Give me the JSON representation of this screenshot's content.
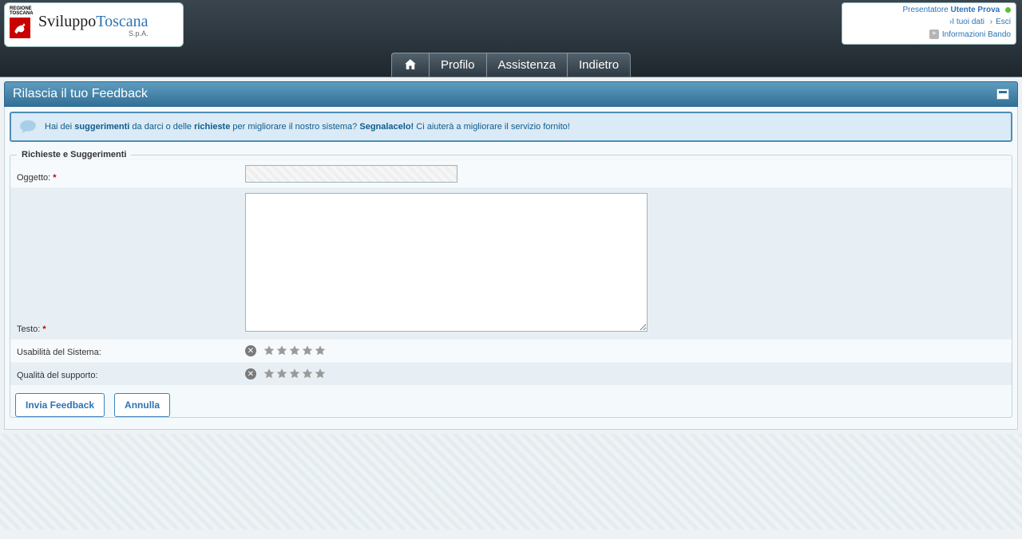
{
  "logo": {
    "region_line1": "REGIONE",
    "region_line2": "TOSCANA",
    "brand_a": "Sviluppo",
    "brand_b": "Toscana",
    "sub": "S.p.A."
  },
  "userbox": {
    "presentatore_label": "Presentatore ",
    "username": "Utente Prova",
    "link_dati": "I tuoi dati",
    "link_esci": "Esci",
    "info_bando": "Informazioni Bando"
  },
  "nav": {
    "profilo": "Profilo",
    "assistenza": "Assistenza",
    "indietro": "Indietro"
  },
  "panel": {
    "title": "Rilascia il tuo Feedback"
  },
  "info": {
    "t1": "Hai dei ",
    "b1": "suggerimenti",
    "t2": " da darci o delle ",
    "b2": "richieste",
    "t3": " per migliorare il nostro sistema? ",
    "b3": "Segnalacelo!",
    "t4": " Ci aiuterà a migliorare il servizio fornito!"
  },
  "form": {
    "legend": "Richieste e Suggerimenti",
    "oggetto_label": "Oggetto:",
    "testo_label": "Testo:",
    "usabilita_label": "Usabilità del Sistema:",
    "qualita_label": "Qualità del supporto:",
    "oggetto_value": "",
    "testo_value": ""
  },
  "buttons": {
    "submit": "Invia Feedback",
    "cancel": "Annulla"
  }
}
